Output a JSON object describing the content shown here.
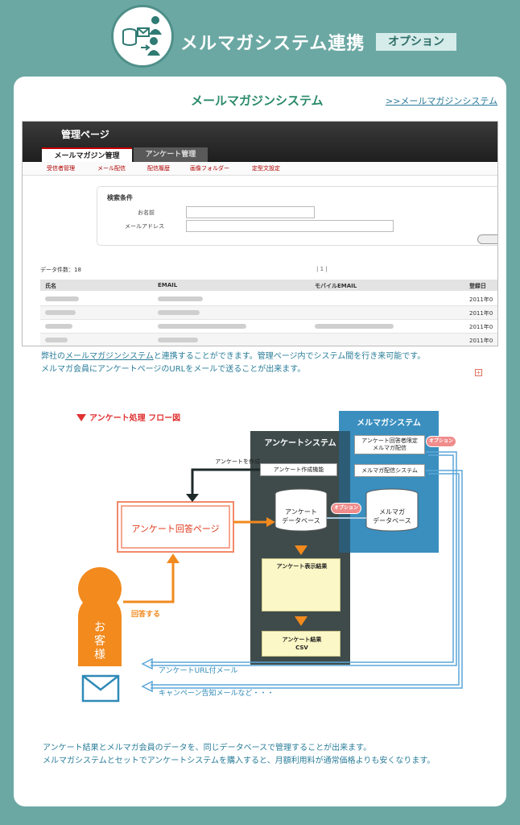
{
  "header": {
    "title": "メルマガシステム連携",
    "badge": "オプション",
    "icon": "database-mail-person-icon"
  },
  "card": {
    "section_title": "メールマガジンシステム",
    "link": ">>メールマガジンシステム"
  },
  "screenshot": {
    "admin_title": "管理ページ",
    "tabs": [
      "メールマガジン管理",
      "アンケート管理"
    ],
    "subnav": [
      "受信者管理",
      "メール配信",
      "配信履歴",
      "画像フォルダー",
      "定型文設定"
    ],
    "search": {
      "title": "検索条件",
      "name_label": "お名前",
      "email_label": "メールアドレス"
    },
    "data_count": "データ件数：18",
    "pager": "| 1 |",
    "columns": [
      "氏名",
      "EMAIL",
      "モバイルEMAIL",
      "登録日"
    ],
    "rows": [
      {
        "date": "2011年0"
      },
      {
        "date": "2011年0"
      },
      {
        "date": "2011年0"
      },
      {
        "date": "2011年0"
      }
    ]
  },
  "description": {
    "pre": "弊社の",
    "link": "メールマガジンシステム",
    "line1_post": "と連携することができます。管理ページ内でシステム間を行き来可能です。",
    "line2": "メルマガ会員にアンケートページのURLをメールで送ることが出来ます。"
  },
  "flow": {
    "title": "アンケート処理 フロー図",
    "survey_panel": "アンケートシステム",
    "mail_panel": "メルマガシステム",
    "create_label": "アンケートを作成",
    "create_func": "アンケート作成機能",
    "survey_db": [
      "アンケート",
      "データベース"
    ],
    "mail_db": [
      "メルマガ",
      "データベース"
    ],
    "option": "オプション",
    "mail_option": "オプション",
    "limited_send": [
      "アンケート回答者限定",
      "メルマガ配信"
    ],
    "mail_send": "メルマガ配信システム",
    "answer_page": "アンケート回答ページ",
    "result_display": "アンケート表示結果",
    "result_csv": [
      "アンケート結果",
      "CSV"
    ],
    "customer": [
      "お",
      "客",
      "様"
    ],
    "answer": "回答する",
    "url_mail": "アンケートURL付メール",
    "campaign_mail": "キャンペーン告知メールなど・・・"
  },
  "bottom": {
    "line1": "アンケート結果とメルマガ会員のデータを、同じデータベースで管理することが出来ます。",
    "line2": "メルマガシステムとセットでアンケートシステムを購入すると、月額利用料が通常価格よりも安くなります。"
  }
}
